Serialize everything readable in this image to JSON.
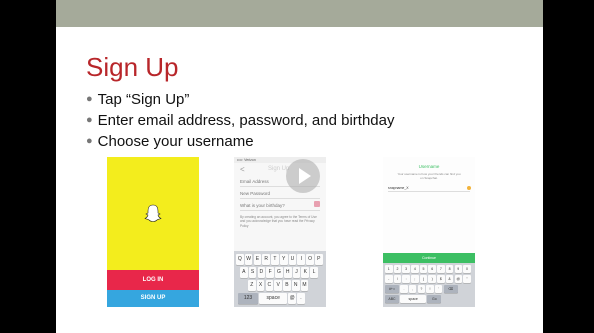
{
  "slide": {
    "title": "Sign Up",
    "bullets": [
      "Tap “Sign Up”",
      "Enter email address, password, and birthday",
      "Choose your username"
    ]
  },
  "phone1": {
    "login_label": "LOG IN",
    "signup_label": "SIGN UP",
    "colors": {
      "background": "#f3ed1d",
      "login": "#e8274a",
      "signup": "#35a6df"
    }
  },
  "phone2": {
    "status": "••••◦ Verizon",
    "back": "<",
    "nav_title": "Sign Up",
    "email_placeholder": "Email Address",
    "password_placeholder": "New Password",
    "birthday_placeholder": "What is your birthday?",
    "terms": "By creating an account, you agree to the Terms of Use and you acknowledge that you have read the Privacy Policy",
    "keyboard": {
      "row1": [
        "Q",
        "W",
        "E",
        "R",
        "T",
        "Y",
        "U",
        "I",
        "O",
        "P"
      ],
      "row2": [
        "A",
        "S",
        "D",
        "F",
        "G",
        "H",
        "J",
        "K",
        "L"
      ],
      "row3": [
        "Z",
        "X",
        "C",
        "V",
        "B",
        "N",
        "M"
      ],
      "row4": [
        "123",
        "space",
        "@",
        "."
      ]
    }
  },
  "phone3": {
    "nav_title": "Username",
    "subtitle": "Your username is how your friends can find you on Snapchat.",
    "username_value": "snapname_X",
    "continue_label": "Continue",
    "keyboard": {
      "row1": [
        "1",
        "2",
        "3",
        "4",
        "5",
        "6",
        "7",
        "8",
        "9",
        "0"
      ],
      "row2": [
        "-",
        "/",
        ":",
        ";",
        "(",
        ")",
        "$",
        "&",
        "@",
        "\""
      ],
      "row3": [
        "#+=",
        ".",
        ",",
        "?",
        "!",
        "'",
        "⌫"
      ],
      "row4": [
        "ABC",
        "space",
        "Go"
      ]
    },
    "colors": {
      "accent": "#3cbf63"
    }
  },
  "overlay": {
    "icon": "play-icon"
  }
}
